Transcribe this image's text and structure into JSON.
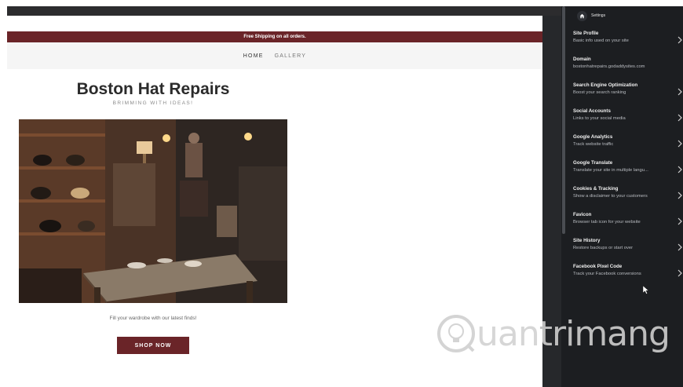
{
  "site": {
    "promo_text": "Free Shipping on all orders.",
    "nav": [
      "HOME",
      "GALLERY"
    ],
    "title": "Boston Hat Repairs",
    "tagline": "BRIMMING WITH IDEAS!",
    "caption": "Fill your wardrobe with our latest finds!",
    "cta_label": "SHOP NOW"
  },
  "settings": {
    "title": "Settings",
    "items": [
      {
        "title": "Site Profile",
        "desc": "Basic info used on your site"
      },
      {
        "title": "Domain",
        "desc": "bostonhatrepairs.godaddysites.com"
      },
      {
        "title": "Search Engine Optimization",
        "desc": "Boost your search ranking"
      },
      {
        "title": "Social Accounts",
        "desc": "Links to your social media"
      },
      {
        "title": "Google Analytics",
        "desc": "Track website traffic"
      },
      {
        "title": "Google Translate",
        "desc": "Translate your site in multiple langu..."
      },
      {
        "title": "Cookies & Tracking",
        "desc": "Show a disclaimer to your customers"
      },
      {
        "title": "Favicon",
        "desc": "Browser tab icon for your website"
      },
      {
        "title": "Site History",
        "desc": "Restore backups or start over"
      },
      {
        "title": "Facebook Pixel Code",
        "desc": "Track your Facebook conversions"
      }
    ]
  },
  "watermark": {
    "first": "Q",
    "mid": "uan",
    "rest": "trimang"
  },
  "colors": {
    "brand": "#6a2428",
    "panel": "#1c1e21"
  }
}
